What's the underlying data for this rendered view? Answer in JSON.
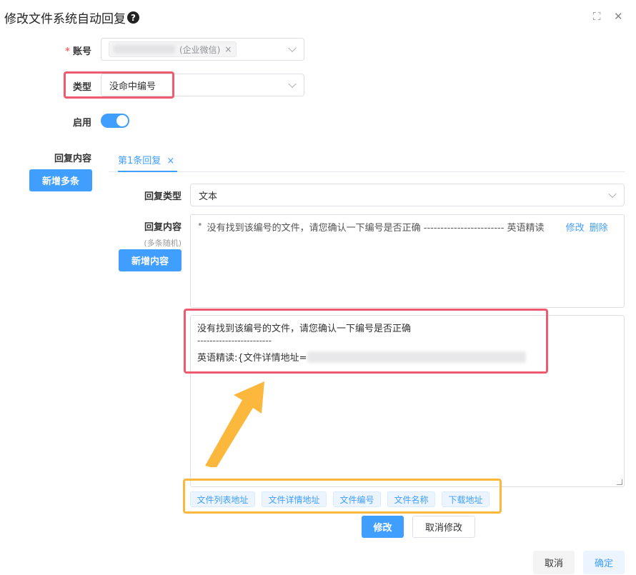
{
  "dialog": {
    "title": "修改文件系统自动回复",
    "help_glyph": "?",
    "fullscreen_glyph": "⛶",
    "close_glyph": "✕"
  },
  "form": {
    "account": {
      "label": "账号",
      "required_mark": "*",
      "tag_text": "(企业微信)",
      "tag_close": "×"
    },
    "type": {
      "label": "类型",
      "value": "没命中编号"
    },
    "enable": {
      "label": "启用",
      "on": true
    },
    "reply_content": {
      "label": "回复内容",
      "add_multi_button": "新增多条"
    }
  },
  "tabs": [
    {
      "label": "第1条回复",
      "close": "×",
      "active": true
    }
  ],
  "reply": {
    "type_label": "回复类型",
    "type_value": "文本",
    "content_label": "回复内容",
    "content_sublabel": "(多条随机)",
    "add_content_button": "新增内容",
    "list_item": {
      "bullet": "•",
      "text": "没有找到该编号的文件，请您确认一下编号是否正确 ------------------------ 英语精读",
      "edit_link": "修改",
      "delete_link": "删除"
    },
    "editor": {
      "line1": "没有找到该编号的文件，请您确认一下编号是否正确",
      "line2": "------------------------",
      "line3_prefix": "英语精读:{文件详情地址="
    },
    "variables": [
      "文件列表地址",
      "文件详情地址",
      "文件编号",
      "文件名称",
      "下载地址"
    ],
    "modify_button": "修改",
    "cancel_modify_button": "取消修改"
  },
  "footer": {
    "cancel_button": "取消",
    "confirm_button": "确定"
  },
  "colors": {
    "primary": "#409eff",
    "highlight_red": "#ee5b6e",
    "highlight_orange": "#fbb83d"
  }
}
